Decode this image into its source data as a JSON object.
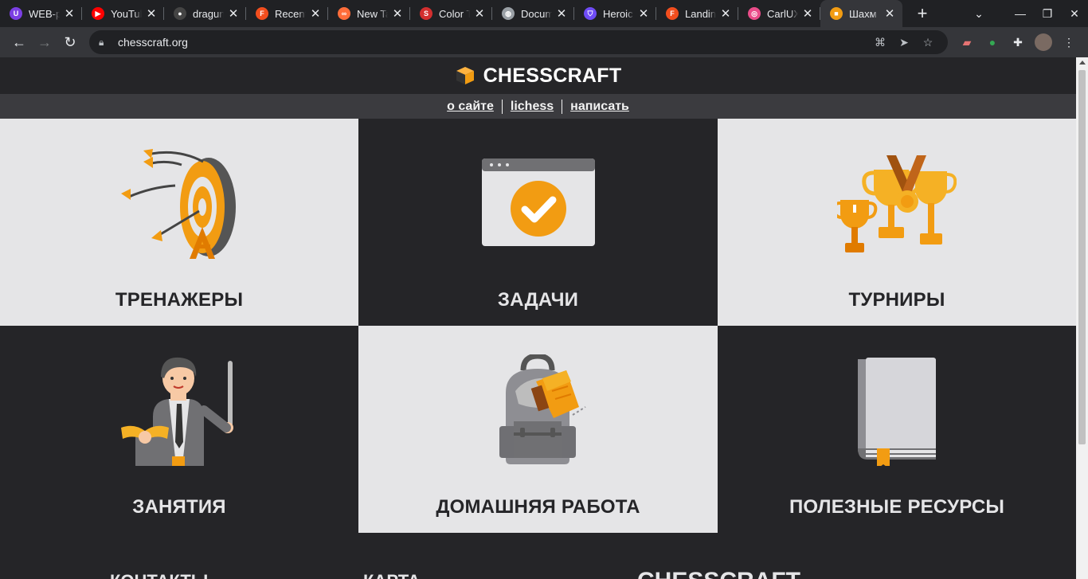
{
  "browser": {
    "tabs": [
      {
        "title": "WEB-p",
        "favicon_color": "#7b3fe4",
        "favicon_glyph": "U"
      },
      {
        "title": "YouTub",
        "favicon_color": "#ff0000",
        "favicon_glyph": "▶"
      },
      {
        "title": "dragun",
        "favicon_color": "#444444",
        "favicon_glyph": "●"
      },
      {
        "title": "Recent",
        "favicon_color": "#f24e1e",
        "favicon_glyph": "F"
      },
      {
        "title": "New Ta",
        "favicon_color": "#ff6d3a",
        "favicon_glyph": "∞"
      },
      {
        "title": "Color T",
        "favicon_color": "#d32f2f",
        "favicon_glyph": "S"
      },
      {
        "title": "Docum",
        "favicon_color": "#9aa0a6",
        "favicon_glyph": "◍"
      },
      {
        "title": "Heroic",
        "favicon_color": "#6f4cf6",
        "favicon_glyph": "⛉"
      },
      {
        "title": "Landin",
        "favicon_color": "#f24e1e",
        "favicon_glyph": "F"
      },
      {
        "title": "CarlUX",
        "favicon_color": "#ea4c89",
        "favicon_glyph": "◎"
      },
      {
        "title": "Шахм",
        "favicon_color": "#f29c12",
        "favicon_glyph": "■"
      }
    ],
    "active_tab_index": 10,
    "url": "chesscraft.org"
  },
  "site": {
    "brand": "CHESSCRAFT",
    "nav": [
      "о сайте",
      "lichess",
      "написать"
    ],
    "tiles": [
      {
        "label": "ТРЕНАЖЕРЫ",
        "icon": "target-icon",
        "theme": "light"
      },
      {
        "label": "ЗАДАЧИ",
        "icon": "checkmark-window-icon",
        "theme": "dark"
      },
      {
        "label": "ТУРНИРЫ",
        "icon": "trophy-icon",
        "theme": "light"
      },
      {
        "label": "ЗАНЯТИЯ",
        "icon": "teacher-icon",
        "theme": "dark"
      },
      {
        "label": "ДОМАШНЯЯ РАБОТА",
        "icon": "backpack-icon",
        "theme": "light"
      },
      {
        "label": "ПОЛЕЗНЫЕ РЕСУРСЫ",
        "icon": "book-icon",
        "theme": "dark"
      }
    ],
    "footer": {
      "contacts": "КОНТАКТЫ",
      "map": "КАРТА",
      "brand": "CHESSCRAFT"
    }
  },
  "colors": {
    "accent": "#f29c12",
    "dark": "#252528",
    "light": "#e5e5e7"
  }
}
